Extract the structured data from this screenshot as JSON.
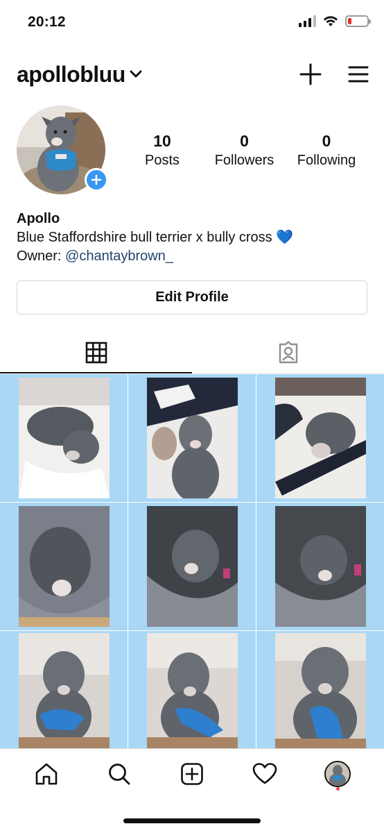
{
  "status_bar": {
    "time": "20:12",
    "battery_level": 0.2,
    "battery_color": "#e0332b",
    "icons": [
      "signal-icon",
      "wifi-icon",
      "battery-icon"
    ]
  },
  "header": {
    "username": "apollobluu",
    "icons": [
      "chevron-down-icon",
      "plus-icon",
      "menu-icon"
    ]
  },
  "profile": {
    "stats": [
      {
        "value": "10",
        "label": "Posts"
      },
      {
        "value": "0",
        "label": "Followers"
      },
      {
        "value": "0",
        "label": "Following"
      }
    ],
    "name": "Apollo",
    "bio_line1": "Blue Staffordshire bull terrier x bully cross",
    "bio_emoji": "💙",
    "owner_prefix": "Owner: ",
    "owner_handle": "@chantaybrown_",
    "edit_button": "Edit Profile"
  },
  "tabs": [
    {
      "icon": "grid-icon",
      "active": true
    },
    {
      "icon": "tagged-icon",
      "active": false
    }
  ],
  "grid": {
    "background": "#a9d7f5",
    "posts": 9
  },
  "bottom_nav": [
    "home-icon",
    "search-icon",
    "new-post-icon",
    "activity-heart-icon",
    "profile-avatar"
  ],
  "colors": {
    "accent": "#3897f0",
    "link": "#24446e",
    "notification_dot": "#ed4956"
  }
}
